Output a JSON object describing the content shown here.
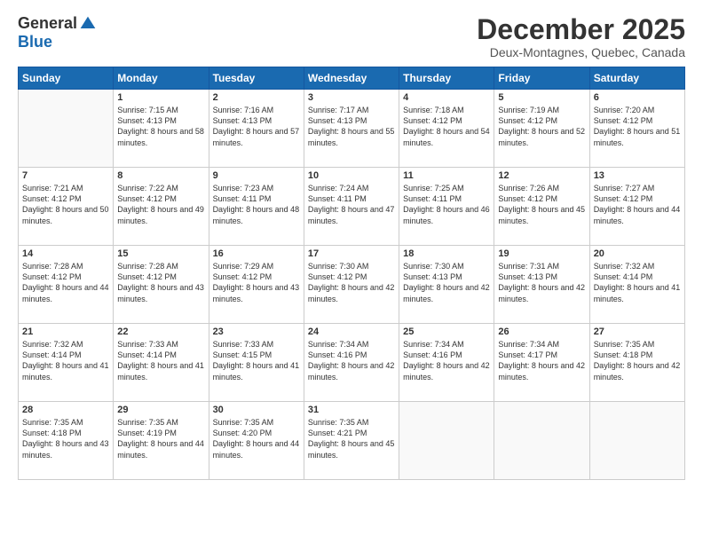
{
  "logo": {
    "general": "General",
    "blue": "Blue"
  },
  "header": {
    "month_year": "December 2025",
    "location": "Deux-Montagnes, Quebec, Canada"
  },
  "days_of_week": [
    "Sunday",
    "Monday",
    "Tuesday",
    "Wednesday",
    "Thursday",
    "Friday",
    "Saturday"
  ],
  "weeks": [
    [
      {
        "day": "",
        "sunrise": "",
        "sunset": "",
        "daylight": ""
      },
      {
        "day": "1",
        "sunrise": "Sunrise: 7:15 AM",
        "sunset": "Sunset: 4:13 PM",
        "daylight": "Daylight: 8 hours and 58 minutes."
      },
      {
        "day": "2",
        "sunrise": "Sunrise: 7:16 AM",
        "sunset": "Sunset: 4:13 PM",
        "daylight": "Daylight: 8 hours and 57 minutes."
      },
      {
        "day": "3",
        "sunrise": "Sunrise: 7:17 AM",
        "sunset": "Sunset: 4:13 PM",
        "daylight": "Daylight: 8 hours and 55 minutes."
      },
      {
        "day": "4",
        "sunrise": "Sunrise: 7:18 AM",
        "sunset": "Sunset: 4:12 PM",
        "daylight": "Daylight: 8 hours and 54 minutes."
      },
      {
        "day": "5",
        "sunrise": "Sunrise: 7:19 AM",
        "sunset": "Sunset: 4:12 PM",
        "daylight": "Daylight: 8 hours and 52 minutes."
      },
      {
        "day": "6",
        "sunrise": "Sunrise: 7:20 AM",
        "sunset": "Sunset: 4:12 PM",
        "daylight": "Daylight: 8 hours and 51 minutes."
      }
    ],
    [
      {
        "day": "7",
        "sunrise": "Sunrise: 7:21 AM",
        "sunset": "Sunset: 4:12 PM",
        "daylight": "Daylight: 8 hours and 50 minutes."
      },
      {
        "day": "8",
        "sunrise": "Sunrise: 7:22 AM",
        "sunset": "Sunset: 4:12 PM",
        "daylight": "Daylight: 8 hours and 49 minutes."
      },
      {
        "day": "9",
        "sunrise": "Sunrise: 7:23 AM",
        "sunset": "Sunset: 4:11 PM",
        "daylight": "Daylight: 8 hours and 48 minutes."
      },
      {
        "day": "10",
        "sunrise": "Sunrise: 7:24 AM",
        "sunset": "Sunset: 4:11 PM",
        "daylight": "Daylight: 8 hours and 47 minutes."
      },
      {
        "day": "11",
        "sunrise": "Sunrise: 7:25 AM",
        "sunset": "Sunset: 4:11 PM",
        "daylight": "Daylight: 8 hours and 46 minutes."
      },
      {
        "day": "12",
        "sunrise": "Sunrise: 7:26 AM",
        "sunset": "Sunset: 4:12 PM",
        "daylight": "Daylight: 8 hours and 45 minutes."
      },
      {
        "day": "13",
        "sunrise": "Sunrise: 7:27 AM",
        "sunset": "Sunset: 4:12 PM",
        "daylight": "Daylight: 8 hours and 44 minutes."
      }
    ],
    [
      {
        "day": "14",
        "sunrise": "Sunrise: 7:28 AM",
        "sunset": "Sunset: 4:12 PM",
        "daylight": "Daylight: 8 hours and 44 minutes."
      },
      {
        "day": "15",
        "sunrise": "Sunrise: 7:28 AM",
        "sunset": "Sunset: 4:12 PM",
        "daylight": "Daylight: 8 hours and 43 minutes."
      },
      {
        "day": "16",
        "sunrise": "Sunrise: 7:29 AM",
        "sunset": "Sunset: 4:12 PM",
        "daylight": "Daylight: 8 hours and 43 minutes."
      },
      {
        "day": "17",
        "sunrise": "Sunrise: 7:30 AM",
        "sunset": "Sunset: 4:12 PM",
        "daylight": "Daylight: 8 hours and 42 minutes."
      },
      {
        "day": "18",
        "sunrise": "Sunrise: 7:30 AM",
        "sunset": "Sunset: 4:13 PM",
        "daylight": "Daylight: 8 hours and 42 minutes."
      },
      {
        "day": "19",
        "sunrise": "Sunrise: 7:31 AM",
        "sunset": "Sunset: 4:13 PM",
        "daylight": "Daylight: 8 hours and 42 minutes."
      },
      {
        "day": "20",
        "sunrise": "Sunrise: 7:32 AM",
        "sunset": "Sunset: 4:14 PM",
        "daylight": "Daylight: 8 hours and 41 minutes."
      }
    ],
    [
      {
        "day": "21",
        "sunrise": "Sunrise: 7:32 AM",
        "sunset": "Sunset: 4:14 PM",
        "daylight": "Daylight: 8 hours and 41 minutes."
      },
      {
        "day": "22",
        "sunrise": "Sunrise: 7:33 AM",
        "sunset": "Sunset: 4:14 PM",
        "daylight": "Daylight: 8 hours and 41 minutes."
      },
      {
        "day": "23",
        "sunrise": "Sunrise: 7:33 AM",
        "sunset": "Sunset: 4:15 PM",
        "daylight": "Daylight: 8 hours and 41 minutes."
      },
      {
        "day": "24",
        "sunrise": "Sunrise: 7:34 AM",
        "sunset": "Sunset: 4:16 PM",
        "daylight": "Daylight: 8 hours and 42 minutes."
      },
      {
        "day": "25",
        "sunrise": "Sunrise: 7:34 AM",
        "sunset": "Sunset: 4:16 PM",
        "daylight": "Daylight: 8 hours and 42 minutes."
      },
      {
        "day": "26",
        "sunrise": "Sunrise: 7:34 AM",
        "sunset": "Sunset: 4:17 PM",
        "daylight": "Daylight: 8 hours and 42 minutes."
      },
      {
        "day": "27",
        "sunrise": "Sunrise: 7:35 AM",
        "sunset": "Sunset: 4:18 PM",
        "daylight": "Daylight: 8 hours and 42 minutes."
      }
    ],
    [
      {
        "day": "28",
        "sunrise": "Sunrise: 7:35 AM",
        "sunset": "Sunset: 4:18 PM",
        "daylight": "Daylight: 8 hours and 43 minutes."
      },
      {
        "day": "29",
        "sunrise": "Sunrise: 7:35 AM",
        "sunset": "Sunset: 4:19 PM",
        "daylight": "Daylight: 8 hours and 44 minutes."
      },
      {
        "day": "30",
        "sunrise": "Sunrise: 7:35 AM",
        "sunset": "Sunset: 4:20 PM",
        "daylight": "Daylight: 8 hours and 44 minutes."
      },
      {
        "day": "31",
        "sunrise": "Sunrise: 7:35 AM",
        "sunset": "Sunset: 4:21 PM",
        "daylight": "Daylight: 8 hours and 45 minutes."
      },
      {
        "day": "",
        "sunrise": "",
        "sunset": "",
        "daylight": ""
      },
      {
        "day": "",
        "sunrise": "",
        "sunset": "",
        "daylight": ""
      },
      {
        "day": "",
        "sunrise": "",
        "sunset": "",
        "daylight": ""
      }
    ]
  ]
}
